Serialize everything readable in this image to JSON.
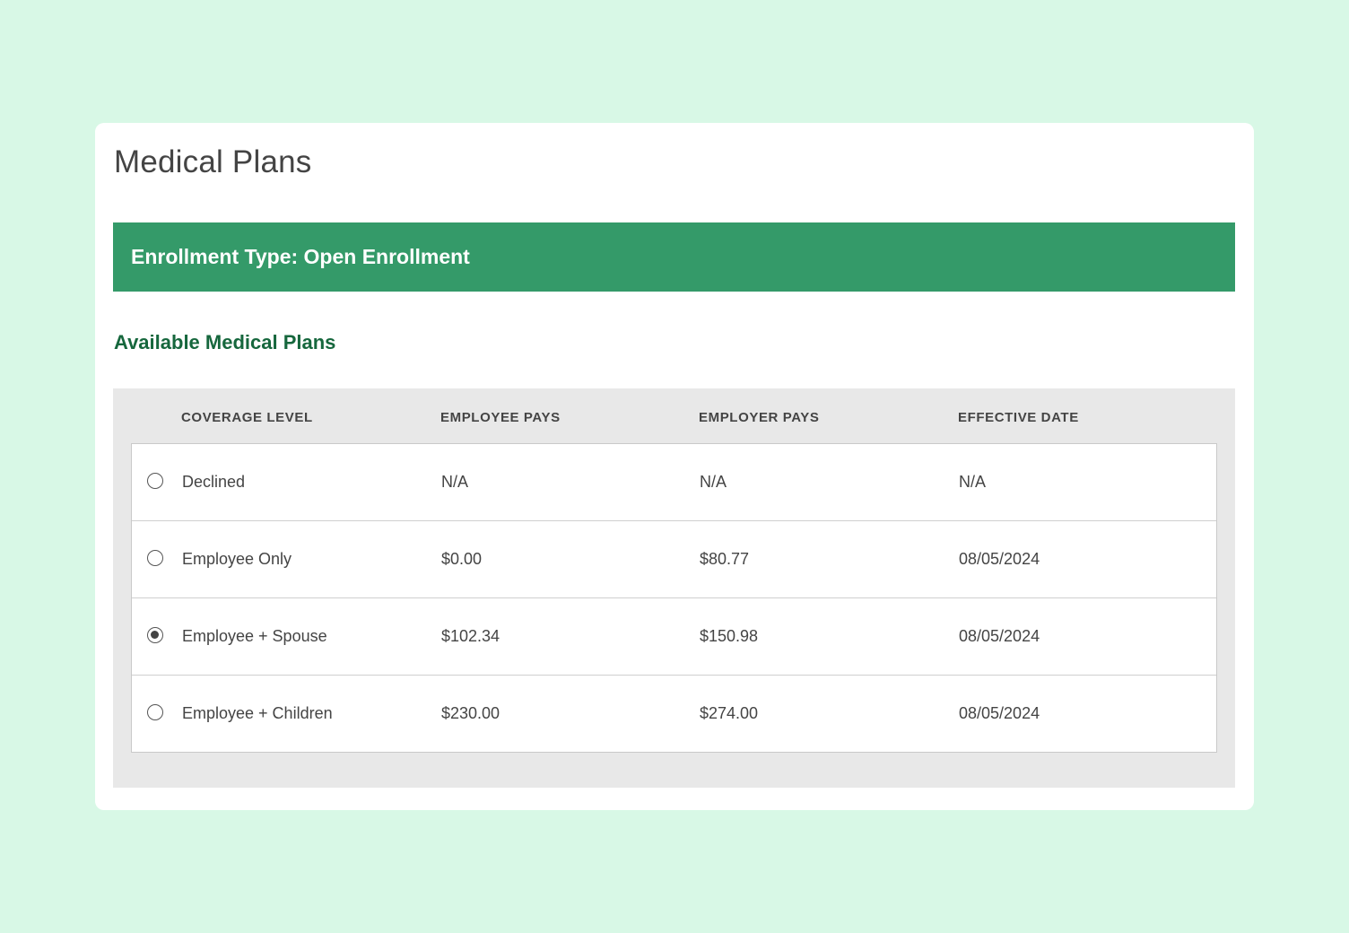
{
  "page": {
    "title": "Medical Plans"
  },
  "banner": {
    "text": "Enrollment Type: Open Enrollment",
    "color": "#349a69"
  },
  "section": {
    "title": "Available Medical Plans",
    "color": "#16673d"
  },
  "table": {
    "headers": [
      "COVERAGE LEVEL",
      "EMPLOYEE PAYS",
      "EMPLOYER PAYS",
      "EFFECTIVE DATE"
    ],
    "rows": [
      {
        "coverage": "Declined",
        "employee_pays": "N/A",
        "employer_pays": "N/A",
        "effective_date": "N/A",
        "selected": false
      },
      {
        "coverage": "Employee Only",
        "employee_pays": "$0.00",
        "employer_pays": "$80.77",
        "effective_date": "08/05/2024",
        "selected": false
      },
      {
        "coverage": "Employee + Spouse",
        "employee_pays": "$102.34",
        "employer_pays": "$150.98",
        "effective_date": "08/05/2024",
        "selected": true
      },
      {
        "coverage": "Employee + Children",
        "employee_pays": "$230.00",
        "employer_pays": "$274.00",
        "effective_date": "08/05/2024",
        "selected": false
      }
    ]
  }
}
